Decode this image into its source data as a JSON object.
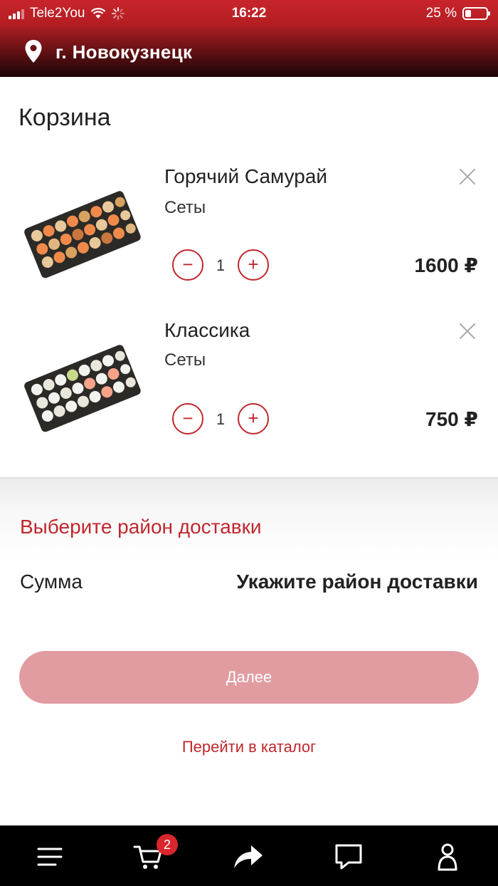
{
  "status_bar": {
    "carrier": "Tele2You",
    "time": "16:22",
    "battery": "25 %",
    "battery_level": 0.25
  },
  "header": {
    "city": "г. Новокузнецк",
    "icon": "location-pin-icon"
  },
  "page_title": "Корзина",
  "cart": {
    "items": [
      {
        "name": "Горячий Самурай",
        "category": "Сеты",
        "qty": "1",
        "price": "1600 ₽",
        "minus": "−",
        "plus": "+"
      },
      {
        "name": "Классика",
        "category": "Сеты",
        "qty": "1",
        "price": "750 ₽",
        "minus": "−",
        "plus": "+"
      }
    ]
  },
  "delivery": {
    "select_district": "Выберите район доставки",
    "sum_label": "Сумма",
    "sum_value": "Укажите район доставки"
  },
  "actions": {
    "next": "Далее",
    "catalog": "Перейти в каталог"
  },
  "tabbar": {
    "cart_badge": "2",
    "icons": [
      "menu-icon",
      "cart-icon",
      "share-icon",
      "chat-icon",
      "profile-icon"
    ]
  },
  "colors": {
    "accent": "#c0272d",
    "button_disabled": "#e19ca2",
    "tabbar": "#000000"
  }
}
